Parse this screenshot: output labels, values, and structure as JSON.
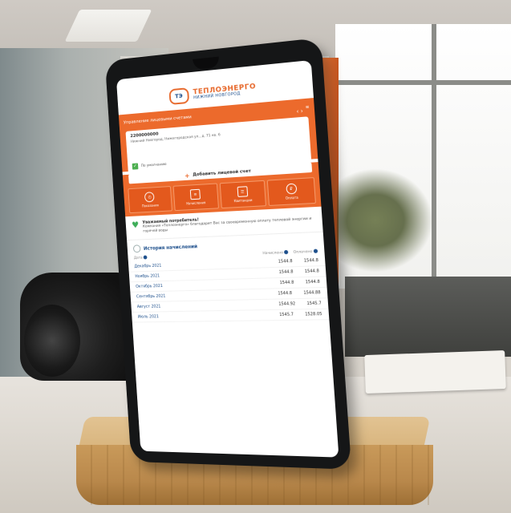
{
  "app": {
    "logo_mark": "ТЭ",
    "logo_name": "ТЕПЛОЭНЕРГО",
    "logo_sub": "НИЖНИЙ НОВГОРОД"
  },
  "account": {
    "header": "Управление лицевыми счетами",
    "number": "2200000000",
    "address": "Нижний Новгород, Нижегородская ул., д. 71 кв. 6",
    "default_label": "По умолчанию",
    "add_button": "Добавить лицевой счет"
  },
  "tiles": [
    {
      "label": "Показания",
      "icon": "meter-icon"
    },
    {
      "label": "Начисления",
      "icon": "document-icon"
    },
    {
      "label": "Квитанции",
      "icon": "receipt-icon"
    },
    {
      "label": "Оплата",
      "icon": "payment-icon"
    }
  ],
  "notice": {
    "title": "Уважаемый потребитель!",
    "text": "Компания «Теплоэнерго» благодарит Вас за своевременную оплату тепловой энергии и горячей воды"
  },
  "history": {
    "title": "История начислений",
    "col_date": "Дата",
    "col_charged": "Начислено",
    "col_paid": "Оплачено",
    "rows": [
      {
        "month": "Декабрь 2021",
        "charged": "1544.8",
        "paid": "1544.8"
      },
      {
        "month": "Ноябрь 2021",
        "charged": "1544.8",
        "paid": "1544.8"
      },
      {
        "month": "Октябрь 2021",
        "charged": "1544.8",
        "paid": "1544.8"
      },
      {
        "month": "Сентябрь 2021",
        "charged": "1544.8",
        "paid": "1544.88"
      },
      {
        "month": "Август 2021",
        "charged": "1544.92",
        "paid": "1545.7"
      },
      {
        "month": "Июль 2021",
        "charged": "1545.7",
        "paid": "1528.05"
      }
    ]
  }
}
